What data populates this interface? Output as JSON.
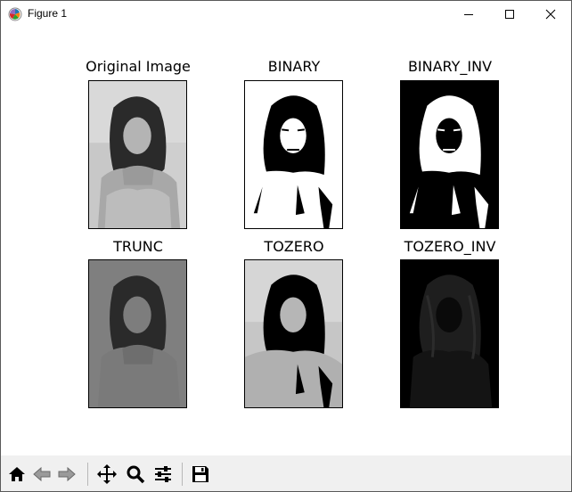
{
  "window": {
    "title": "Figure 1",
    "controls": [
      "minimize-icon",
      "maximize-icon",
      "close-icon"
    ]
  },
  "figure": {
    "subplots": [
      {
        "title": "Original Image",
        "variant": "original"
      },
      {
        "title": "BINARY",
        "variant": "binary"
      },
      {
        "title": "BINARY_INV",
        "variant": "binary_inv"
      },
      {
        "title": "TRUNC",
        "variant": "trunc"
      },
      {
        "title": "TOZERO",
        "variant": "tozero"
      },
      {
        "title": "TOZERO_INV",
        "variant": "tozero_inv"
      }
    ]
  },
  "toolbar": {
    "buttons": [
      "home-icon",
      "back-icon",
      "forward-icon",
      "pan-icon",
      "zoom-icon",
      "configure-subplots-icon",
      "save-icon"
    ]
  },
  "colors": {
    "toolbar_bg": "#f0f0f0",
    "window_border": "#5a5a5a"
  }
}
